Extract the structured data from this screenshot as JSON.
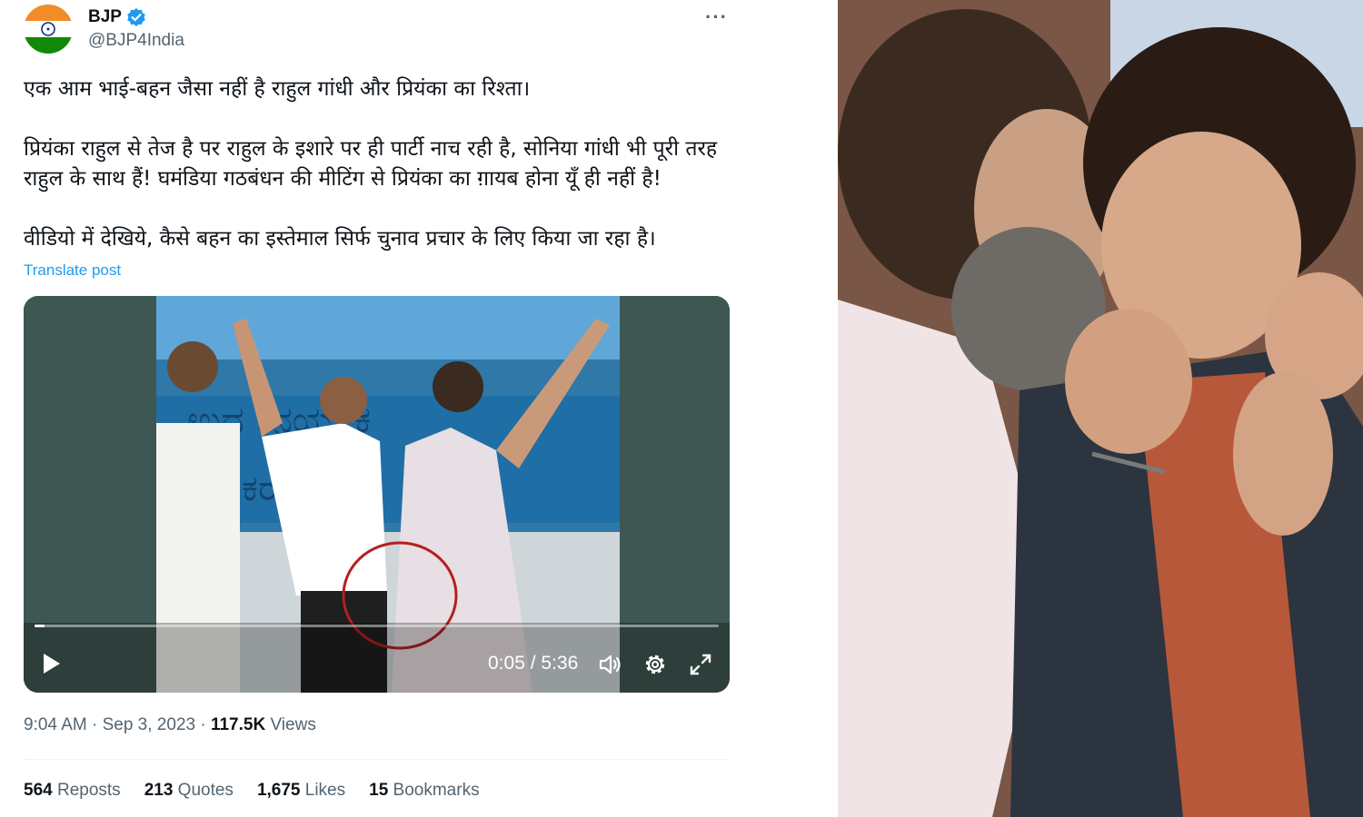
{
  "tweet": {
    "display_name": "BJP",
    "handle": "@BJP4India",
    "more_icon": "···",
    "paragraphs": [
      "एक आम भाई-बहन जैसा नहीं है राहुल गांधी और प्रियंका का रिश्ता।",
      "प्रियंका राहुल से तेज है पर राहुल के इशारे पर ही पार्टी नाच रही है, सोनिया गांधी भी पूरी तरह राहुल के साथ हैं! घमंडिया गठबंधन की मीटिंग से प्रियंका का ग़ायब होना यूँ ही नहीं है!",
      "वीडियो में देखिये, कैसे बहन का इस्तेमाल सिर्फ चुनाव प्रचार के लिए किया जा रहा है।"
    ],
    "translate_label": "Translate post",
    "video": {
      "time": "0:05 / 5:36",
      "progress": 0.015
    },
    "timestamp": "9:04 AM · Sep 3, 2023 · ",
    "views_count": "117.5K",
    "views_label": " Views",
    "stats": [
      {
        "count": "564",
        "label": "Reposts"
      },
      {
        "count": "213",
        "label": "Quotes"
      },
      {
        "count": "1,675",
        "label": "Likes"
      },
      {
        "count": "15",
        "label": "Bookmarks"
      }
    ]
  },
  "colors": {
    "link": "#1d9bf0",
    "secondary_text": "#536471",
    "verified": "#1d9bf0"
  }
}
